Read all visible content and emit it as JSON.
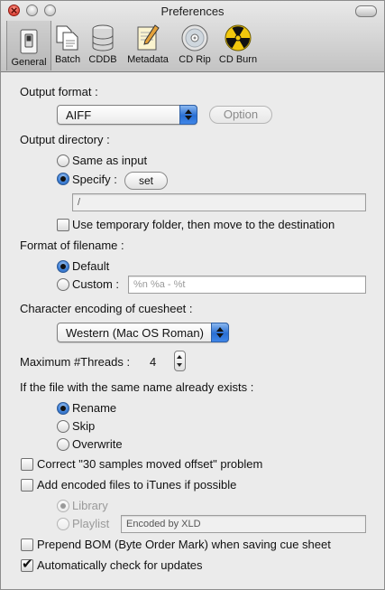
{
  "window": {
    "title": "Preferences"
  },
  "toolbar": {
    "items": [
      {
        "label": "General",
        "icon": "switch-icon",
        "selected": true
      },
      {
        "label": "Batch",
        "icon": "documents-icon"
      },
      {
        "label": "CDDB",
        "icon": "database-icon"
      },
      {
        "label": "Metadata",
        "icon": "pencil-icon"
      },
      {
        "label": "CD Rip",
        "icon": "cd-icon"
      },
      {
        "label": "CD Burn",
        "icon": "radiation-icon"
      }
    ]
  },
  "output_format": {
    "label": "Output format :",
    "value": "AIFF",
    "option_button": "Option"
  },
  "output_directory": {
    "label": "Output directory :",
    "same_as_input": "Same as input",
    "specify": "Specify :",
    "set_button": "set",
    "path": "/",
    "temp_folder": "Use temporary folder, then move to the destination"
  },
  "filename_format": {
    "label": "Format of filename :",
    "default": "Default",
    "custom": "Custom :",
    "custom_placeholder": "%n %a - %t"
  },
  "cuesheet_encoding": {
    "label": "Character encoding of cuesheet :",
    "value": "Western (Mac OS Roman)"
  },
  "threads": {
    "label": "Maximum #Threads :",
    "value": "4"
  },
  "file_exists": {
    "label": "If the file with the same name already exists :",
    "rename": "Rename",
    "skip": "Skip",
    "overwrite": "Overwrite"
  },
  "options": {
    "correct_offset": "Correct \"30 samples moved offset\" problem",
    "add_itunes": "Add encoded files to iTunes if possible",
    "library": "Library",
    "playlist": "Playlist",
    "playlist_value": "Encoded by XLD",
    "prepend_bom": "Prepend BOM (Byte Order Mark) when saving cue sheet",
    "auto_update": "Automatically check for updates"
  }
}
